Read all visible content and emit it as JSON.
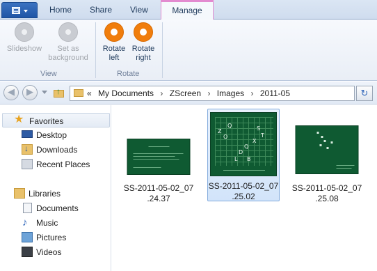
{
  "ribbon": {
    "tabs": [
      "Home",
      "Share",
      "View"
    ],
    "active_tab": "Manage",
    "buttons": {
      "slideshow": "Slideshow",
      "set_as": "Set as",
      "background": "background",
      "rotate_left_1": "Rotate",
      "rotate_left_2": "left",
      "rotate_right_1": "Rotate",
      "rotate_right_2": "right"
    },
    "groups": {
      "view": "View",
      "rotate": "Rotate"
    }
  },
  "address": {
    "overflow": "«",
    "segments": [
      "My Documents",
      "ZScreen",
      "Images",
      "2011-05"
    ],
    "separator": "›"
  },
  "navigation": {
    "favorites": {
      "label": "Favorites",
      "items": [
        "Desktop",
        "Downloads",
        "Recent Places"
      ]
    },
    "libraries": {
      "label": "Libraries",
      "items": [
        "Documents",
        "Music",
        "Pictures",
        "Videos"
      ]
    }
  },
  "files": [
    {
      "name_line1": "SS-2011-05-02_07",
      "name_line2": ".24.37",
      "selected": false
    },
    {
      "name_line1": "SS-2011-05-02_07",
      "name_line2": ".25.02",
      "selected": true
    },
    {
      "name_line1": "SS-2011-05-02_07",
      "name_line2": ".25.08",
      "selected": false
    }
  ],
  "colors": {
    "accent_manage": "#e38ad0",
    "rotate_orange": "#f07d0c",
    "selection": "#84acdd"
  },
  "icons": {
    "favorites": "star-icon",
    "desktop": "desktop-icon",
    "downloads": "downloads-icon",
    "recent": "recent-places-icon",
    "libraries": "libraries-icon",
    "documents": "documents-icon",
    "music": "music-icon",
    "pictures": "pictures-icon",
    "videos": "videos-icon"
  }
}
